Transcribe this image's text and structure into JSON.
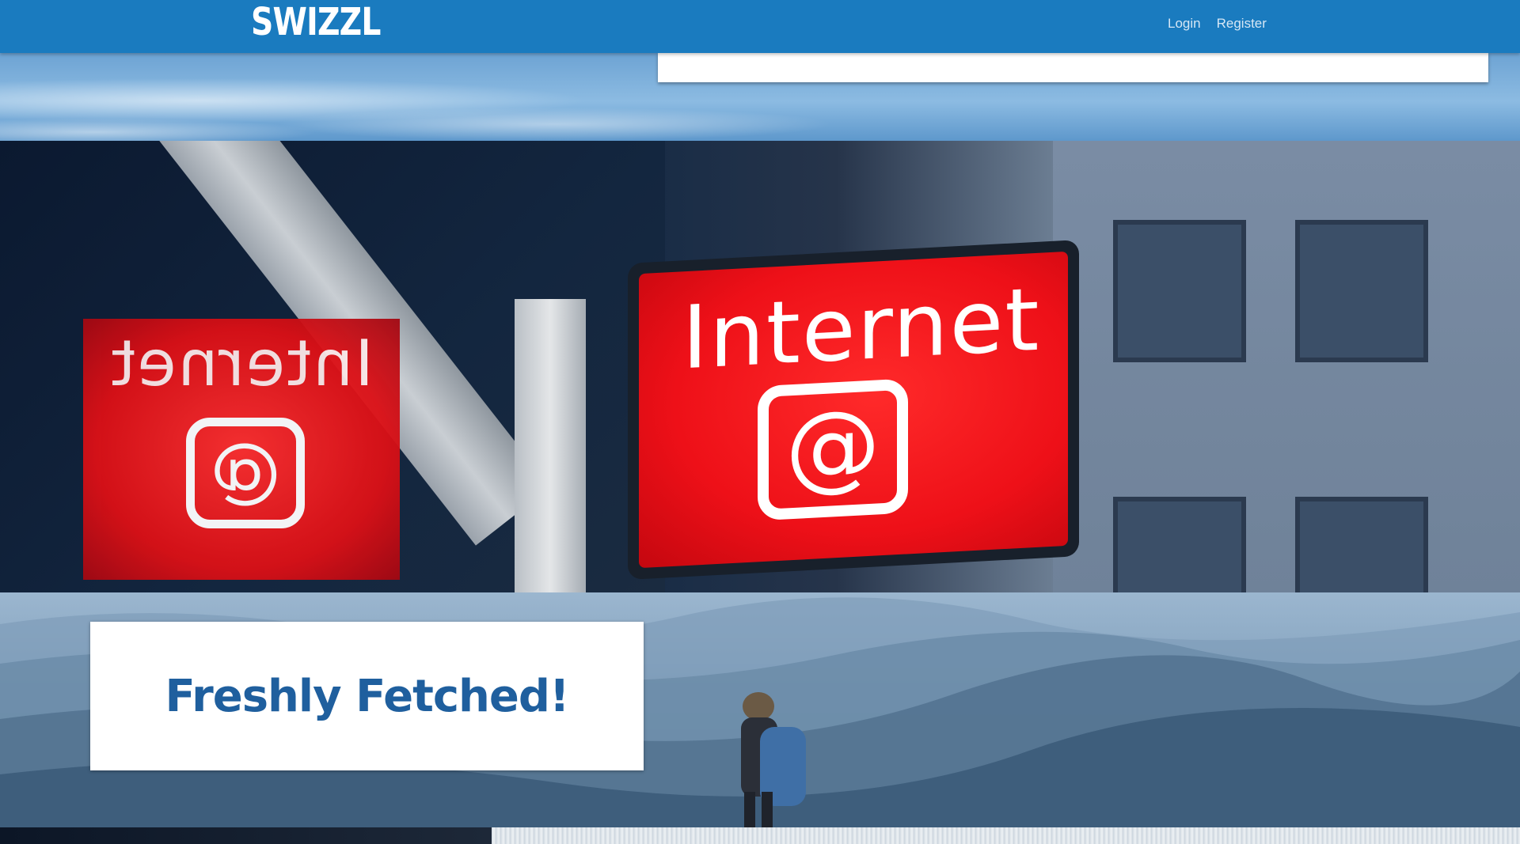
{
  "navbar": {
    "brand": "SWIZZL",
    "links": {
      "login": "Login",
      "register": "Register"
    },
    "color": "#1a7bbf"
  },
  "hero": {
    "sign_text": "Internet",
    "sign_symbol": "@",
    "sign_color": "#ee1018"
  },
  "promo": {
    "title": "Freshly Fetched!",
    "title_color": "#1f5f9e"
  }
}
